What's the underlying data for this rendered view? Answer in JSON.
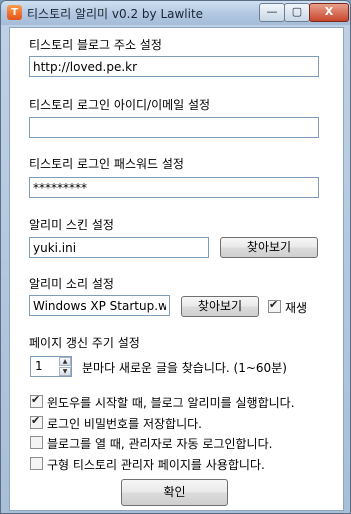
{
  "window": {
    "title": "티스토리 알리미 v0.2 by Lawlite",
    "icon_glyph": "T",
    "minimize_glyph": "—",
    "maximize_glyph": "▢",
    "close_glyph": "X"
  },
  "fields": {
    "blog_address_label": "티스토리 블로그 주소 설정",
    "blog_address_value": "http://loved.pe.kr",
    "login_id_label": "티스토리 로그인 아이디/이메일 설정",
    "login_id_value": "",
    "password_label": "티스토리 로그인 패스워드 설정",
    "password_value": "*********",
    "skin_label": "알리미 스킨 설정",
    "skin_value": "yuki.ini",
    "skin_browse_button": "찾아보기",
    "sound_label": "알리미 소리 설정",
    "sound_value": "Windows XP Startup.wa",
    "sound_browse_button": "찾아보기",
    "sound_play_label": "재생",
    "refresh_label": "페이지 갱신 주기 설정",
    "refresh_value": "1",
    "refresh_suffix": "분마다 새로운 글을 찾습니다. (1~60분)"
  },
  "options": [
    {
      "label": "윈도우를 시작할 때, 블로그 알리미를 실행합니다.",
      "checked": true
    },
    {
      "label": "로그인 비밀번호를 저장합니다.",
      "checked": true
    },
    {
      "label": "블로그를 열 때, 관리자로 자동 로그인합니다.",
      "checked": false
    },
    {
      "label": "구형 티스토리 관리자 페이지를 사용합니다.",
      "checked": false
    }
  ],
  "sound_play_checked": true,
  "ok_button": "확인",
  "colors": {
    "accent": "#7f9db9",
    "titlebar": "#b3c9e2",
    "close": "#c9472c"
  }
}
